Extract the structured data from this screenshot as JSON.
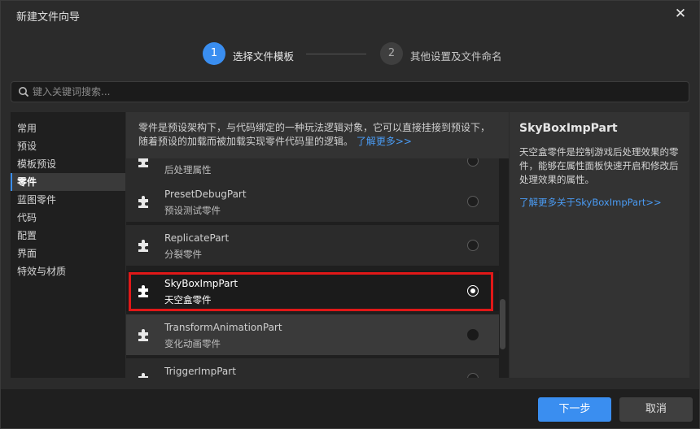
{
  "window": {
    "title": "新建文件向导"
  },
  "steps": [
    {
      "number": "1",
      "label": "选择文件模板"
    },
    {
      "number": "2",
      "label": "其他设置及文件命名"
    }
  ],
  "search": {
    "placeholder": "键入关键词搜索..."
  },
  "sidebar": {
    "items": [
      "常用",
      "预设",
      "模板预设",
      "零件",
      "蓝图零件",
      "代码",
      "配置",
      "界面",
      "特效与材质"
    ],
    "selected": "零件"
  },
  "list": {
    "description_line1": "零件是预设架构下，与代码绑定的一种玩法逻辑对象，它可以直接挂接到预设下，",
    "description_line2": "随着预设的加载而被加载实现零件代码里的逻辑。",
    "learn_more": "了解更多>>",
    "items": [
      {
        "name": "",
        "desc": "后处理属性"
      },
      {
        "name": "PresetDebugPart",
        "desc": "预设测试零件"
      },
      {
        "name": "ReplicatePart",
        "desc": "分裂零件"
      },
      {
        "name": "SkyBoxImpPart",
        "desc": "天空盒零件"
      },
      {
        "name": "TransformAnimationPart",
        "desc": "变化动画零件"
      },
      {
        "name": "TriggerImpPart",
        "desc": ""
      }
    ],
    "selected": "SkyBoxImpPart"
  },
  "detail": {
    "title": "SkyBoxImpPart",
    "description": "天空盒零件是控制游戏后处理效果的零件，能够在属性面板快速开启和修改后处理效果的属性。",
    "link": "了解更多关于SkyBoxImpPart>>"
  },
  "footer": {
    "next_label": "下一步",
    "cancel_label": "取消"
  },
  "colors": {
    "accent": "#3a8ef0",
    "highlight": "#e01818",
    "link": "#4a9cf5"
  }
}
